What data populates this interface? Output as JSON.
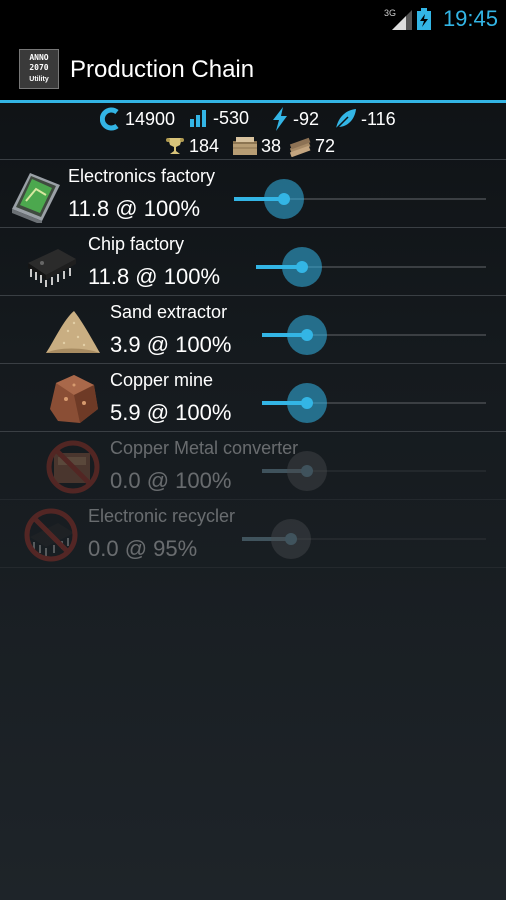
{
  "status_bar": {
    "network": "3G",
    "time": "19:45"
  },
  "action_bar": {
    "title": "Production Chain",
    "app_icon_lines": [
      "ANNO",
      "2070",
      "Utility"
    ]
  },
  "resources": [
    {
      "icon": "credits-icon",
      "value": "14900"
    },
    {
      "icon": "balance-bars-icon",
      "value": "-530"
    },
    {
      "icon": "energy-bolt-icon",
      "value": "-92"
    },
    {
      "icon": "eco-leaf-icon",
      "value": "-116"
    },
    {
      "icon": "research-trophy-icon",
      "value": "184"
    },
    {
      "icon": "tools-crate-icon",
      "value": "38"
    },
    {
      "icon": "building-materials-icon",
      "value": "72"
    }
  ],
  "production": [
    {
      "name": "Electronics factory",
      "value": "11.8 @ 100%",
      "efficiency": 100,
      "level": 0.2,
      "enabled": true,
      "icon": "electronics-icon"
    },
    {
      "name": "Chip factory",
      "value": "11.8 @ 100%",
      "efficiency": 100,
      "level": 0.2,
      "enabled": true,
      "icon": "chip-icon"
    },
    {
      "name": "Sand extractor",
      "value": "3.9 @ 100%",
      "efficiency": 100,
      "level": 0.2,
      "enabled": true,
      "icon": "sand-icon"
    },
    {
      "name": "Copper mine",
      "value": "5.9 @ 100%",
      "efficiency": 100,
      "level": 0.2,
      "enabled": true,
      "icon": "copper-ore-icon"
    },
    {
      "name": "Copper Metal converter",
      "value": "0.0 @ 100%",
      "efficiency": 100,
      "level": 0.2,
      "enabled": false,
      "icon": "copper-converter-icon"
    },
    {
      "name": "Electronic recycler",
      "value": "0.0 @ 95%",
      "efficiency": 95,
      "level": 0.2,
      "enabled": false,
      "icon": "recycler-icon"
    }
  ],
  "colors": {
    "accent": "#33b5e5",
    "background": "#1a1f23",
    "divider": "#3a3f44"
  }
}
